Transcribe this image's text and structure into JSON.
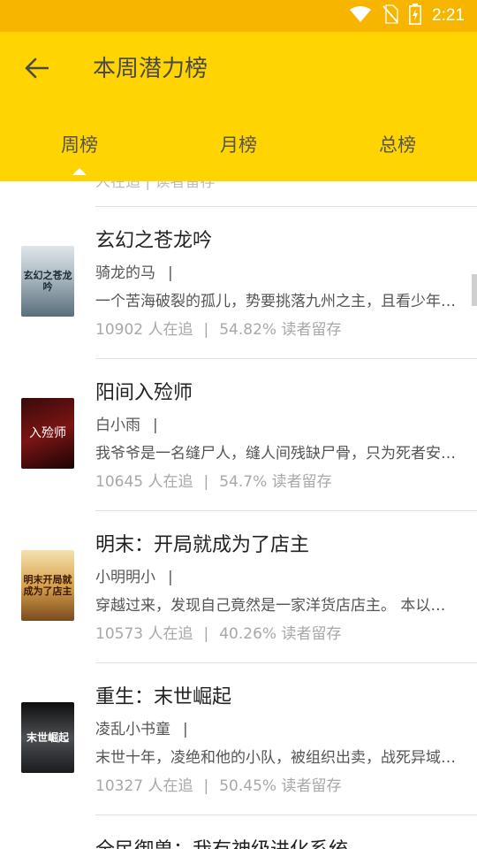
{
  "status_bar": {
    "time": "2:21"
  },
  "header": {
    "title": "本周潜力榜"
  },
  "tabs": [
    {
      "label": "周榜",
      "active": true
    },
    {
      "label": "月榜",
      "active": false
    },
    {
      "label": "总榜",
      "active": false
    }
  ],
  "list": {
    "partial_top_text": "人在追  |  读者留存",
    "items": [
      {
        "title": "玄幻之苍龙吟",
        "author": "骑龙的马",
        "author_sep": "|",
        "description": "一个苦海破裂的孤儿，势要挑落九州之主，且看少年如何逆天而行……",
        "followers": "10902 人在追",
        "retention": "54.82% 读者留存",
        "cover_text": "玄幻之苍龙吟"
      },
      {
        "title": "阳间入殓师",
        "author": "白小雨",
        "author_sep": "|",
        "description": "我爷爷是一名缝尸人，缝人间残缺尸骨，只为死者安息……",
        "followers": "10645 人在追",
        "retention": "54.7% 读者留存",
        "cover_text": "入殓师"
      },
      {
        "title": "明末：开局就成为了店主",
        "author": "小明明小",
        "author_sep": "|",
        "description": "穿越过来，发现自己竟然是一家洋货店店主。 本以为……",
        "followers": "10573 人在追",
        "retention": "40.26% 读者留存",
        "cover_text": "明末开局就成为了店主"
      },
      {
        "title": "重生：末世崛起",
        "author": "凌乱小书童",
        "author_sep": "|",
        "description": "末世十年，凌绝和他的小队，被组织出卖，战死异域……",
        "followers": "10327 人在追",
        "retention": "50.45% 读者留存",
        "cover_text": "末世崛起"
      }
    ],
    "partial_bottom_title": "全民御兽：我有神级进化系统"
  },
  "colors": {
    "status_bar": "#f7b500",
    "app_bar": "#ffd400"
  },
  "icons": {
    "back": "arrow-left-icon",
    "wifi": "wifi-icon",
    "sim": "no-sim-icon",
    "battery": "battery-charging-icon"
  }
}
